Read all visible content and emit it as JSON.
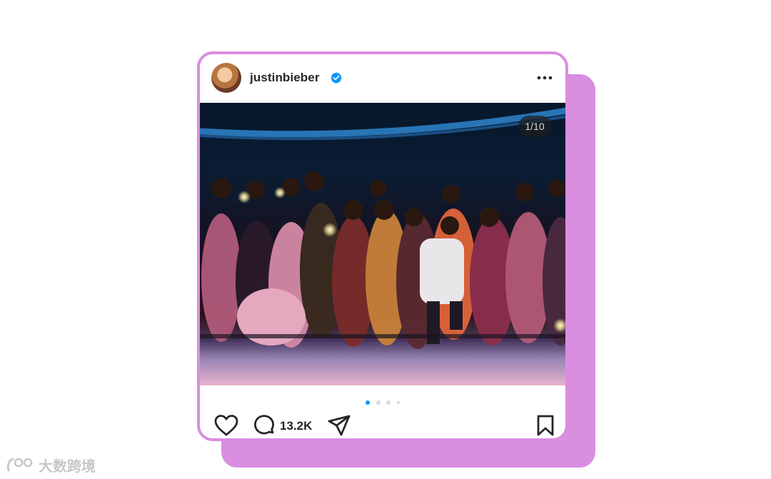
{
  "post": {
    "username": "justinbieber",
    "verified": true,
    "image_counter": "1/10",
    "carousel": {
      "total_dots": 4,
      "active_index": 0
    },
    "comment_count": "13.2K",
    "colors": {
      "frame": "#d98ee0",
      "verified_badge": "#0095f6",
      "active_dot": "#0095f6"
    },
    "icons": {
      "more": "more-horizontal-icon",
      "like": "heart-icon",
      "comment": "comment-bubble-icon",
      "share": "send-icon",
      "save": "bookmark-icon",
      "verified": "verified-badge-icon"
    }
  },
  "watermark": {
    "text": "大数跨境"
  }
}
